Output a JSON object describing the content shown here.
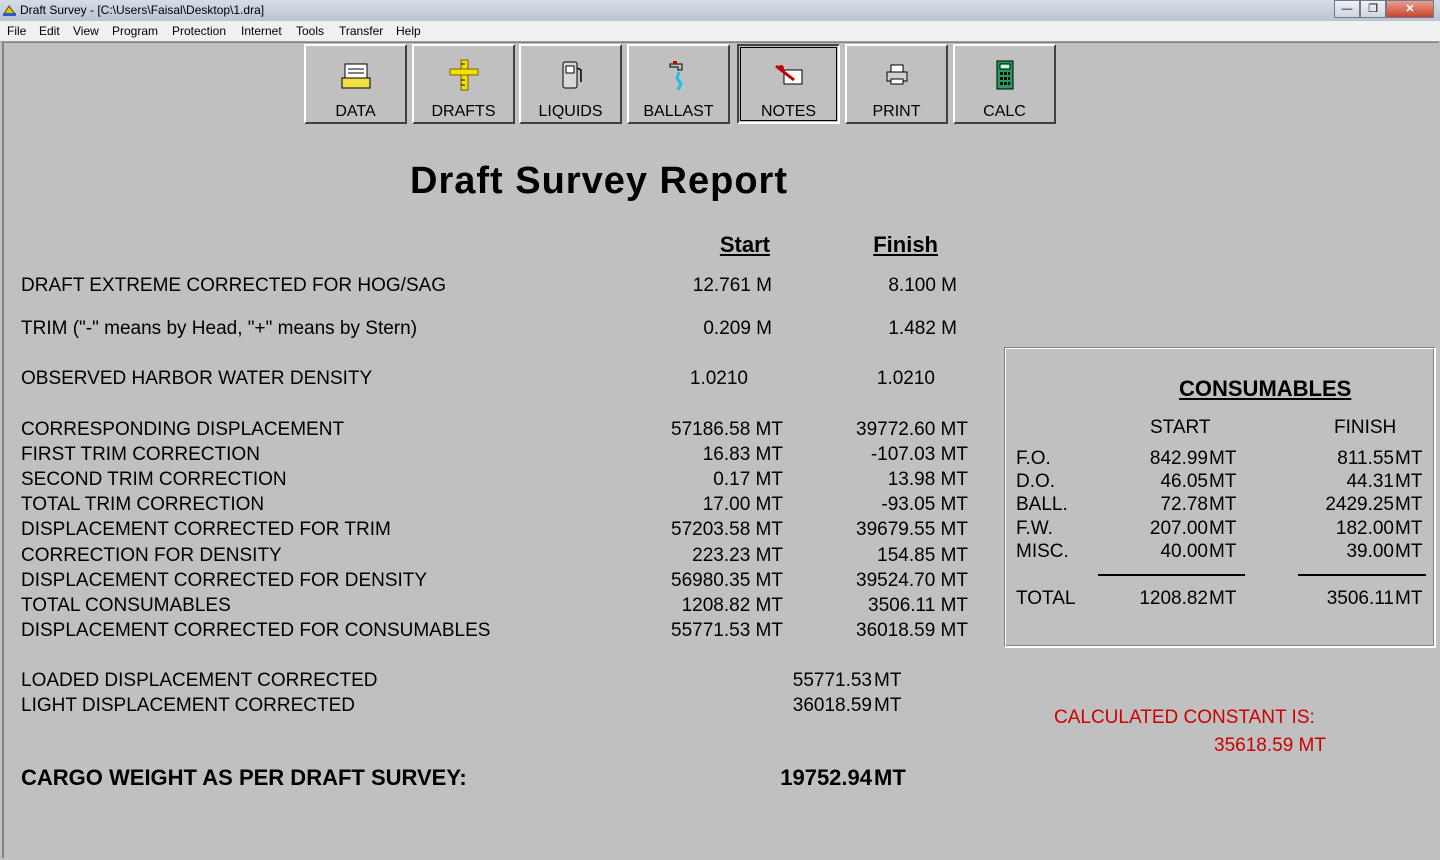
{
  "window": {
    "title": "Draft Survey - [C:\\Users\\Faisal\\Desktop\\1.dra]",
    "min_label": "—",
    "max_label": "❐",
    "close_label": "✕"
  },
  "menu": [
    "File",
    "Edit",
    "View",
    "Program",
    "Protection",
    "Internet",
    "Tools",
    "Transfer",
    "Help"
  ],
  "toolbar": [
    {
      "label": "DATA",
      "icon": "document-icon"
    },
    {
      "label": "DRAFTS",
      "icon": "ruler-cross-icon"
    },
    {
      "label": "LIQUIDS",
      "icon": "fuel-pump-icon"
    },
    {
      "label": "BALLAST",
      "icon": "water-tap-icon"
    },
    {
      "label": "NOTES",
      "icon": "notes-icon"
    },
    {
      "label": "PRINT",
      "icon": "printer-icon"
    },
    {
      "label": "CALC",
      "icon": "calculator-icon"
    }
  ],
  "report": {
    "title": "Draft  Survey  Report",
    "col_start": "Start",
    "col_finish": "Finish",
    "rows_top": [
      {
        "label": "DRAFT  EXTREME  CORRECTED  FOR  HOG/SAG",
        "start": "12.761  M",
        "finish": "8.100  M"
      },
      {
        "label": "TRIM (\"-\" means by Head, \"+\" means by Stern)",
        "start": "0.209  M",
        "finish": "1.482  M"
      },
      {
        "label": "OBSERVED HARBOR WATER DENSITY",
        "start": "1.0210",
        "finish": "1.0210"
      }
    ],
    "rows": [
      {
        "label": "CORRESPONDING DISPLACEMENT",
        "start": "57186.58 MT",
        "finish": "39772.60 MT"
      },
      {
        "label": "FIRST TRIM CORRECTION",
        "start": "16.83 MT",
        "finish": "-107.03 MT"
      },
      {
        "label": "SECOND TRIM CORRECTION",
        "start": "0.17 MT",
        "finish": "13.98 MT"
      },
      {
        "label": "TOTAL TRIM CORRECTION",
        "start": "17.00 MT",
        "finish": "-93.05 MT"
      },
      {
        "label": "DISPLACEMENT CORRECTED FOR TRIM",
        "start": "57203.58 MT",
        "finish": "39679.55 MT"
      },
      {
        "label": "CORRECTION FOR DENSITY",
        "start": "223.23 MT",
        "finish": "154.85 MT"
      },
      {
        "label": "DISPLACEMENT CORRECTED FOR DENSITY",
        "start": "56980.35 MT",
        "finish": "39524.70 MT"
      },
      {
        "label": "TOTAL CONSUMABLES",
        "start": "1208.82 MT",
        "finish": "3506.11 MT"
      },
      {
        "label": "DISPLACEMENT CORRECTED FOR CONSUMABLES",
        "start": "55771.53 MT",
        "finish": "36018.59 MT"
      }
    ],
    "loaded_label": "LOADED DISPLACEMENT CORRECTED",
    "loaded_value": "55771.53",
    "light_label": "LIGHT DISPLACEMENT CORRECTED",
    "light_value": "36018.59",
    "unit": "MT",
    "cargo_label": "CARGO WEIGHT AS PER DRAFT SURVEY:",
    "cargo_value": "19752.94",
    "cargo_unit": "MT"
  },
  "consumables": {
    "title": "CONSUMABLES",
    "col_start": "START",
    "col_finish": "FINISH",
    "unit": "MT",
    "items": [
      {
        "label": "F.O.",
        "start": "842.99",
        "finish": "811.55"
      },
      {
        "label": "D.O.",
        "start": "46.05",
        "finish": "44.31"
      },
      {
        "label": "BALL.",
        "start": "72.78",
        "finish": "2429.25"
      },
      {
        "label": "F.W.",
        "start": "207.00",
        "finish": "182.00"
      },
      {
        "label": "MISC.",
        "start": "40.00",
        "finish": "39.00"
      }
    ],
    "total_label": "TOTAL",
    "total_start": "1208.82",
    "total_finish": "3506.11"
  },
  "constant": {
    "label": "CALCULATED CONSTANT IS:",
    "value": "35618.59  MT"
  },
  "colors": {
    "accent_red": "#cc0000",
    "background": "#c0c0c0"
  }
}
